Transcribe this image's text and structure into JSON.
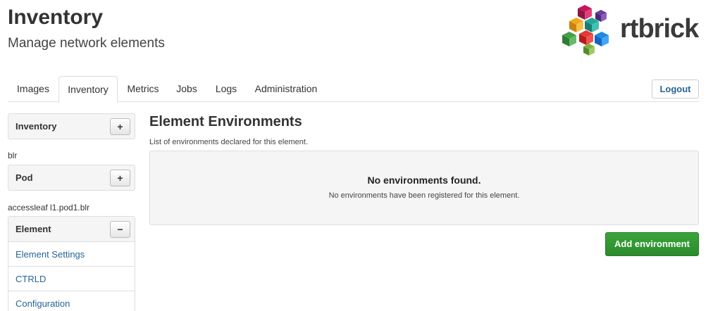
{
  "header": {
    "title": "Inventory",
    "subtitle": "Manage network elements",
    "logo_text": "rtbrick"
  },
  "tabs": [
    {
      "label": "Images",
      "active": false
    },
    {
      "label": "Inventory",
      "active": true
    },
    {
      "label": "Metrics",
      "active": false
    },
    {
      "label": "Jobs",
      "active": false
    },
    {
      "label": "Logs",
      "active": false
    },
    {
      "label": "Administration",
      "active": false
    }
  ],
  "logout_label": "Logout",
  "sidebar": {
    "inventory_panel": {
      "title": "Inventory",
      "button": "+"
    },
    "inventory_selection": "blr",
    "pod_panel": {
      "title": "Pod",
      "button": "+"
    },
    "pod_selection": "accessleaf l1.pod1.blr",
    "element_panel": {
      "title": "Element",
      "button": "−",
      "links": [
        "Element Settings",
        "CTRLD",
        "Configuration"
      ]
    }
  },
  "main": {
    "title": "Element Environments",
    "description": "List of environments declared for this element.",
    "empty_title": "No environments found.",
    "empty_description": "No environments have been registered for this element.",
    "add_button": "Add environment"
  },
  "colors": {
    "link": "#2a6496",
    "primary_green": "#2c8b2c",
    "panel_bg": "#f5f5f5",
    "border": "#dddddd"
  }
}
